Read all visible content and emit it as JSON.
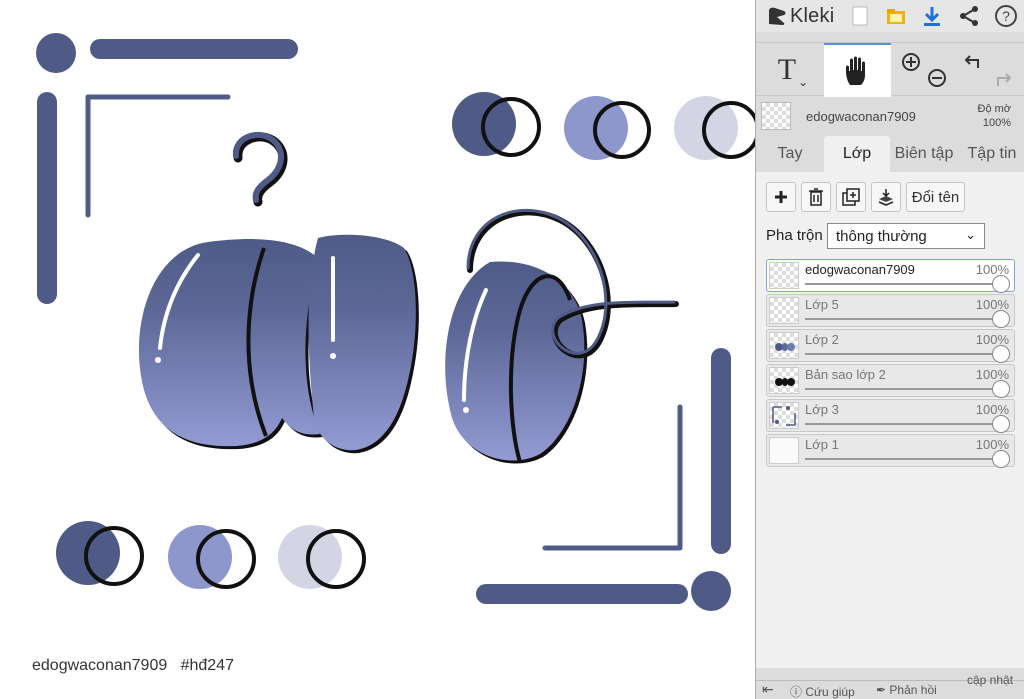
{
  "app": {
    "name": "Kleki"
  },
  "canvas": {
    "caption": "edogwaconan7909   #hđ247",
    "colors": {
      "dark": "#4f5b86",
      "mid": "#8e97cc",
      "light": "#d3d5e4",
      "stroke": "#111111",
      "bg": "#ffffff"
    }
  },
  "topbar": {
    "icons": [
      "new-file-icon",
      "open-folder-icon",
      "download-icon",
      "share-icon",
      "help-icon"
    ],
    "download_color": "#1e73d6",
    "folder_color": "#f0b400"
  },
  "tools": {
    "text_label": "T",
    "items": [
      "text-tool",
      "hand-tool",
      "zoom-in",
      "zoom-out",
      "undo",
      "redo"
    ]
  },
  "layer_header": {
    "name": "edogwaconan7909",
    "opacity_label": "Độ mờ",
    "opacity_value": "100%"
  },
  "tabs": [
    {
      "label": "Tay",
      "active": false
    },
    {
      "label": "Lớp",
      "active": true
    },
    {
      "label": "Biên tập",
      "active": false
    },
    {
      "label": "Tập tin",
      "active": false
    }
  ],
  "layer_buttons": {
    "rename_label": "Đổi tên"
  },
  "blend": {
    "label": "Pha trộn",
    "value": "thông thường"
  },
  "layers": [
    {
      "name": "edogwaconan7909",
      "opacity": "100%",
      "selected": true
    },
    {
      "name": "Lớp 5",
      "opacity": "100%",
      "selected": false
    },
    {
      "name": "Lớp 2",
      "opacity": "100%",
      "selected": false
    },
    {
      "name": "Bản sao lớp 2",
      "opacity": "100%",
      "selected": false
    },
    {
      "name": "Lớp 3",
      "opacity": "100%",
      "selected": false
    },
    {
      "name": "Lớp 1",
      "opacity": "100%",
      "selected": false
    }
  ],
  "bottombar": {
    "help_label": "Cứu giúp",
    "feedback_label": "Phản hồi",
    "update_label": "cập nhật"
  }
}
